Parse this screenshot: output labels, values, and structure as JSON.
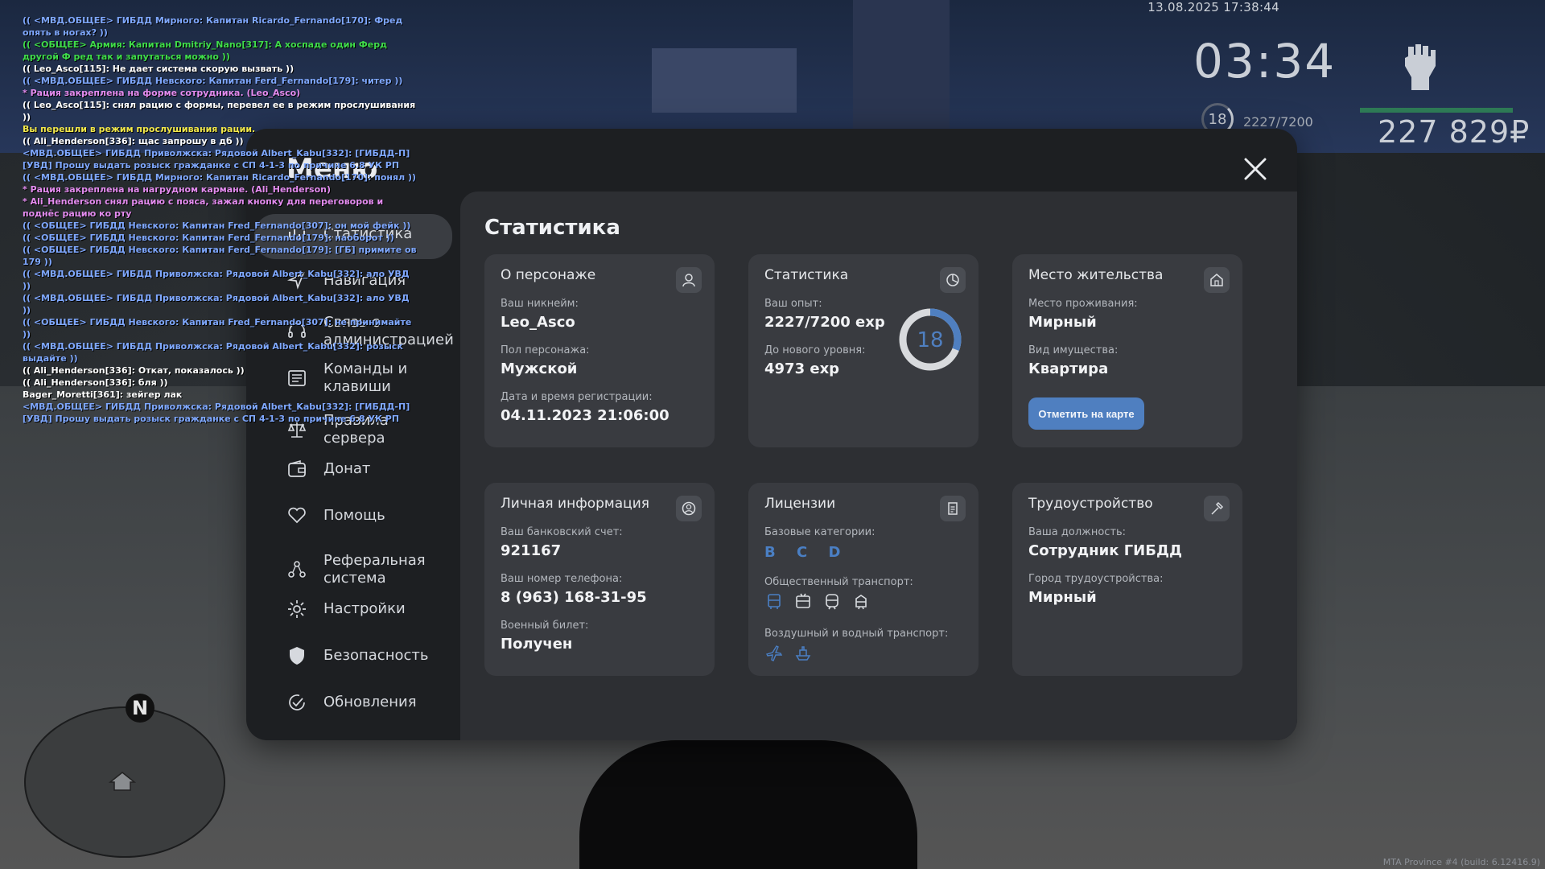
{
  "hud": {
    "datetime": "13.08.2025 17:38:44",
    "clock": "03:34",
    "level": "18",
    "exp": "2227/7200",
    "money": "227 829₽"
  },
  "chat": [
    {
      "text": "(( <МВД.ОБЩЕЕ> ГИБДД Мирного: Капитан Ricardo_Fernando[170]: Фред опять в ногах? ))",
      "color": "#7fa8ff"
    },
    {
      "text": "(( <ОБЩЕЕ> Армия: Капитан Dmitriy_Nano[317]: А хоспаде один Ферд другой Ф ред так и запутаться можно ))",
      "color": "#3fdc4a"
    },
    {
      "text": "(( Leo_Asco[115]: Не дает система скорую вызвать ))",
      "color": "#ffffff"
    },
    {
      "text": "(( <МВД.ОБЩЕЕ> ГИБДД Невского: Капитан Ferd_Fernando[179]: читер ))",
      "color": "#7fa8ff"
    },
    {
      "text": "* Рация закреплена на форме сотрудника. (Leo_Asco)",
      "color": "#e48cf0"
    },
    {
      "text": "(( Leo_Asco[115]: снял рацию с формы, перевел ее в режим прослушивания ))",
      "color": "#ffffff"
    },
    {
      "text": "Вы перешли в режим прослушивания рации.",
      "color": "#f2e84a"
    },
    {
      "text": "(( Ali_Henderson[336]: щас запрошу в дб ))",
      "color": "#ffffff"
    },
    {
      "text": "<МВД.ОБЩЕЕ> ГИБДД Приволжска: Рядовой Albert_Kabu[332]: [ГИБДД-П] [УВД] Прошу выдать розыск гражданке с СП 4-1-3 по причине 6.8 УК РП",
      "color": "#7fa8ff"
    },
    {
      "text": "(( <МВД.ОБЩЕЕ> ГИБДД Мирного: Капитан Ricardo_Fernando[170]: понял ))",
      "color": "#7fa8ff"
    },
    {
      "text": "* Рация закреплена на нагрудном кармане. (Ali_Henderson)",
      "color": "#e48cf0"
    },
    {
      "text": "* Ali_Henderson снял рацию с пояса, зажал кнопку для переговоров и поднёс рацию ко рту",
      "color": "#e48cf0"
    },
    {
      "text": "(( <ОБЩЕЕ> ГИБДД Невского: Капитан Fred_Fernando[307]: он мой фейк ))",
      "color": "#7fa8ff"
    },
    {
      "text": "(( <ОБЩЕЕ> ГИБДД Невского: Капитан Ferd_Fernando[179]: наоборот ))",
      "color": "#7fa8ff"
    },
    {
      "text": "(( <ОБЩЕЕ> ГИБДД Невского: Капитан Ferd_Fernando[179]: [ГБ] примите ов 179 ))",
      "color": "#7fa8ff"
    },
    {
      "text": "(( <МВД.ОБЩЕЕ> ГИБДД Приволжска: Рядовой Albert_Kabu[332]: ало УВД ))",
      "color": "#7fa8ff"
    },
    {
      "text": "(( <МВД.ОБЩЕЕ> ГИБДД Приволжска: Рядовой Albert_Kabu[332]: ало УВД ))",
      "color": "#7fa8ff"
    },
    {
      "text": "(( <ОБЩЕЕ> ГИБДД Невского: Капитан Fred_Fernando[307]: не принимайте ))",
      "color": "#7fa8ff"
    },
    {
      "text": "(( <МВД.ОБЩЕЕ> ГИБДД Приволжска: Рядовой Albert_Kabu[332]: розыск выдайте ))",
      "color": "#7fa8ff"
    },
    {
      "text": "(( Ali_Henderson[336]: Откат, показалось ))",
      "color": "#ffffff"
    },
    {
      "text": "(( Ali_Henderson[336]: бля ))",
      "color": "#ffffff"
    },
    {
      "text": "Bager_Moretti[361]: зейгер лак",
      "color": "#ffffff"
    },
    {
      "text": "<МВД.ОБЩЕЕ> ГИБДД Приволжска: Рядовой Albert_Kabu[332]: [ГИБДД-П] [УВД] Прошу выдать розыск гражданке с СП 4-1-3 по причине 6.8 УК РП",
      "color": "#7fa8ff"
    }
  ],
  "menu": {
    "title": "Меню",
    "nav": [
      {
        "label": "Статистика",
        "icon": "chart-icon",
        "name": "nav-statistics"
      },
      {
        "label": "Навигация",
        "icon": "navigation-icon",
        "name": "nav-navigation"
      },
      {
        "label": "Связь с администрацией",
        "icon": "headset-icon",
        "name": "nav-admin-contact"
      },
      {
        "label": "Команды и клавиши",
        "icon": "keyboard-icon",
        "name": "nav-commands"
      },
      {
        "label": "Правила сервера",
        "icon": "scales-icon",
        "name": "nav-rules"
      },
      {
        "label": "Донат",
        "icon": "wallet-icon",
        "name": "nav-donate"
      },
      {
        "label": "Помощь",
        "icon": "heart-hands-icon",
        "name": "nav-help"
      },
      {
        "label": "Реферальная система",
        "icon": "referral-icon",
        "name": "nav-referral"
      },
      {
        "label": "Настройки",
        "icon": "gear-icon",
        "name": "nav-settings"
      },
      {
        "label": "Безопасность",
        "icon": "shield-icon",
        "name": "nav-security"
      },
      {
        "label": "Обновления",
        "icon": "updates-icon",
        "name": "nav-updates"
      }
    ]
  },
  "content": {
    "title": "Статистика",
    "character": {
      "title": "О персонаже",
      "nickname_label": "Ваш никнейм:",
      "nickname": "Leo_Asco",
      "gender_label": "Пол персонажа:",
      "gender": "Мужской",
      "reg_label": "Дата и время регистрации:",
      "reg": "04.11.2023 21:06:00"
    },
    "stats": {
      "title": "Статистика",
      "exp_label": "Ваш опыт:",
      "exp": "2227/7200 exp",
      "next_label": "До нового уровня:",
      "next": "4973 exp",
      "level": "18",
      "progress": 0.309
    },
    "residence": {
      "title": "Место жительства",
      "place_label": "Место проживания:",
      "place": "Мирный",
      "type_label": "Вид имущества:",
      "type": "Квартира",
      "button": "Отметить на карте"
    },
    "personal": {
      "title": "Личная информация",
      "bank_label": "Ваш банковский счет:",
      "bank": "921167",
      "phone_label": "Ваш номер телефона:",
      "phone": "8 (963) 168-31-95",
      "military_label": "Военный билет:",
      "military": "Получен"
    },
    "licenses": {
      "title": "Лицензии",
      "base_label": "Базовые категории:",
      "base": "B C D",
      "public_label": "Общественный транспорт:",
      "air_label": "Воздушный и водный транспорт:"
    },
    "job": {
      "title": "Трудоустройство",
      "position_label": "Ваша должность:",
      "position": "Сотрудник ГИБДД",
      "city_label": "Город трудоустройства:",
      "city": "Мирный"
    }
  },
  "minimap": {
    "north": "N"
  },
  "build": "MTA Province #4 (build: 6.12416.9)",
  "colors": {
    "accent": "#4f7fc0",
    "license": "#4a7fc4",
    "money_bar": "#2d7a55"
  }
}
